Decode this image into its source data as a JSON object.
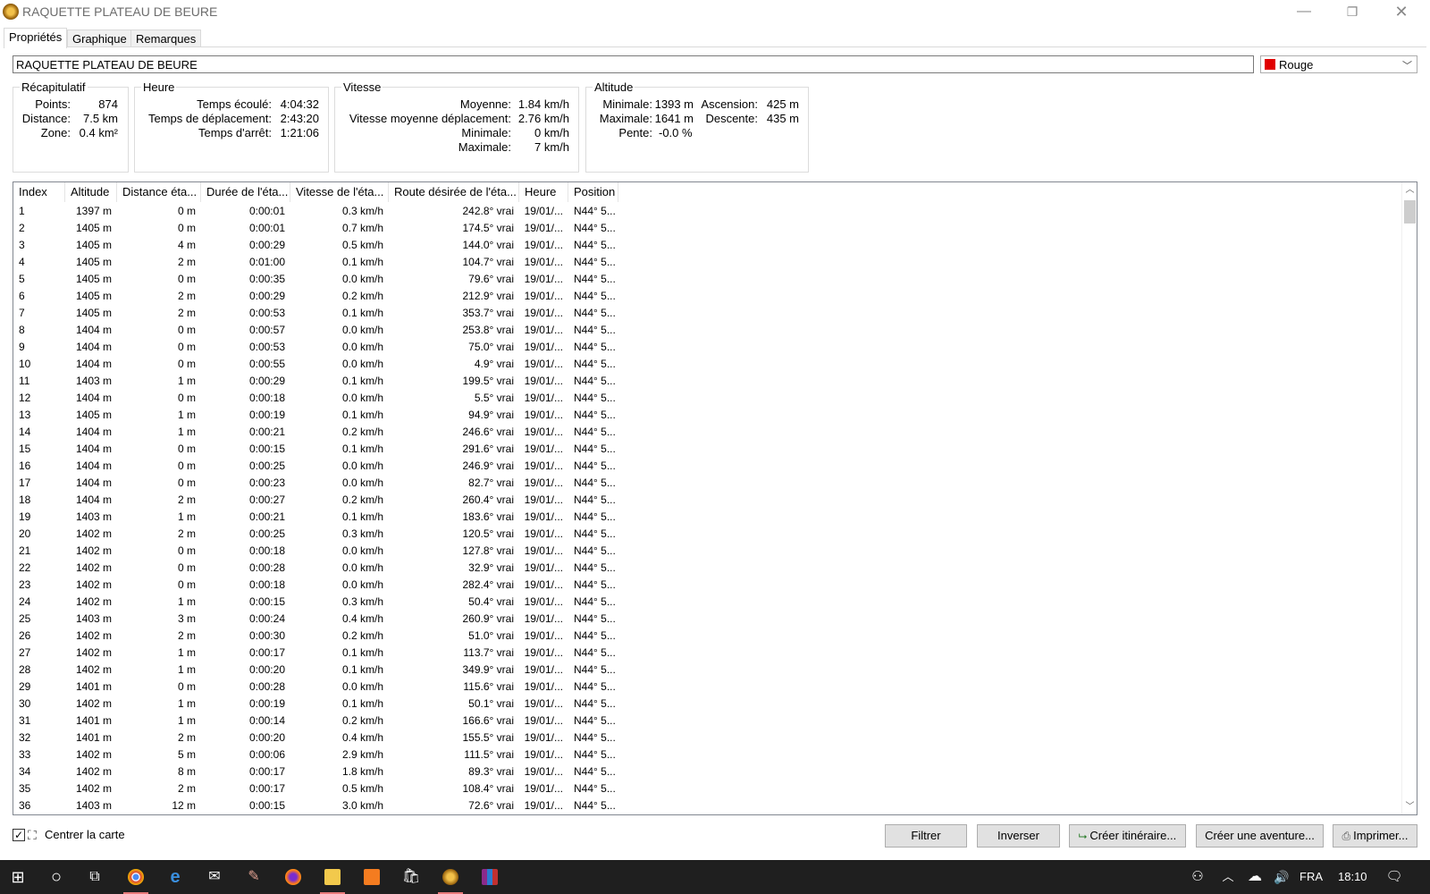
{
  "window": {
    "title": "RAQUETTE PLATEAU DE BEURE"
  },
  "tabs": [
    "Propriétés",
    "Graphique",
    "Remarques"
  ],
  "name_field": {
    "value": "RAQUETTE PLATEAU DE BEURE"
  },
  "color_select": {
    "value": "Rouge",
    "swatch_color": "#e00000"
  },
  "summary": {
    "title": "Récapitulatif",
    "points_label": "Points:",
    "points": "874",
    "distance_label": "Distance:",
    "distance": "7.5 km",
    "zone_label": "Zone:",
    "zone": "0.4 km²"
  },
  "time": {
    "title": "Heure",
    "elapsed_label": "Temps écoulé:",
    "elapsed": "4:04:32",
    "moving_label": "Temps de déplacement:",
    "moving": "2:43:20",
    "stopped_label": "Temps d'arrêt:",
    "stopped": "1:21:06"
  },
  "speed": {
    "title": "Vitesse",
    "avg_label": "Moyenne:",
    "avg": "1.84 km/h",
    "moving_avg_label": "Vitesse moyenne déplacement:",
    "moving_avg": "2.76 km/h",
    "min_label": "Minimale:",
    "min": "0 km/h",
    "max_label": "Maximale:",
    "max": "7 km/h"
  },
  "altitude": {
    "title": "Altitude",
    "min_label": "Minimale:",
    "min": "1393 m",
    "max_label": "Maximale:",
    "max": "1641 m",
    "slope_label": "Pente:",
    "slope": "-0.0 %",
    "ascent_label": "Ascension:",
    "ascent": "425 m",
    "descent_label": "Descente:",
    "descent": "435 m"
  },
  "table": {
    "columns": [
      "Index",
      "Altitude",
      "Distance éta...",
      "Durée de l'éta...",
      "Vitesse de l'éta...",
      "Route désirée de l'éta...",
      "Heure",
      "Position"
    ],
    "rows": [
      [
        "1",
        "1397 m",
        "0 m",
        "0:00:01",
        "0.3 km/h",
        "242.8° vrai",
        "19/01/...",
        "N44° 5..."
      ],
      [
        "2",
        "1405 m",
        "0 m",
        "0:00:01",
        "0.7 km/h",
        "174.5° vrai",
        "19/01/...",
        "N44° 5..."
      ],
      [
        "3",
        "1405 m",
        "4 m",
        "0:00:29",
        "0.5 km/h",
        "144.0° vrai",
        "19/01/...",
        "N44° 5..."
      ],
      [
        "4",
        "1405 m",
        "2 m",
        "0:01:00",
        "0.1 km/h",
        "104.7° vrai",
        "19/01/...",
        "N44° 5..."
      ],
      [
        "5",
        "1405 m",
        "0 m",
        "0:00:35",
        "0.0 km/h",
        "79.6° vrai",
        "19/01/...",
        "N44° 5..."
      ],
      [
        "6",
        "1405 m",
        "2 m",
        "0:00:29",
        "0.2 km/h",
        "212.9° vrai",
        "19/01/...",
        "N44° 5..."
      ],
      [
        "7",
        "1405 m",
        "2 m",
        "0:00:53",
        "0.1 km/h",
        "353.7° vrai",
        "19/01/...",
        "N44° 5..."
      ],
      [
        "8",
        "1404 m",
        "0 m",
        "0:00:57",
        "0.0 km/h",
        "253.8° vrai",
        "19/01/...",
        "N44° 5..."
      ],
      [
        "9",
        "1404 m",
        "0 m",
        "0:00:53",
        "0.0 km/h",
        "75.0° vrai",
        "19/01/...",
        "N44° 5..."
      ],
      [
        "10",
        "1404 m",
        "0 m",
        "0:00:55",
        "0.0 km/h",
        "4.9° vrai",
        "19/01/...",
        "N44° 5..."
      ],
      [
        "11",
        "1403 m",
        "1 m",
        "0:00:29",
        "0.1 km/h",
        "199.5° vrai",
        "19/01/...",
        "N44° 5..."
      ],
      [
        "12",
        "1404 m",
        "0 m",
        "0:00:18",
        "0.0 km/h",
        "5.5° vrai",
        "19/01/...",
        "N44° 5..."
      ],
      [
        "13",
        "1405 m",
        "1 m",
        "0:00:19",
        "0.1 km/h",
        "94.9° vrai",
        "19/01/...",
        "N44° 5..."
      ],
      [
        "14",
        "1404 m",
        "1 m",
        "0:00:21",
        "0.2 km/h",
        "246.6° vrai",
        "19/01/...",
        "N44° 5..."
      ],
      [
        "15",
        "1404 m",
        "0 m",
        "0:00:15",
        "0.1 km/h",
        "291.6° vrai",
        "19/01/...",
        "N44° 5..."
      ],
      [
        "16",
        "1404 m",
        "0 m",
        "0:00:25",
        "0.0 km/h",
        "246.9° vrai",
        "19/01/...",
        "N44° 5..."
      ],
      [
        "17",
        "1404 m",
        "0 m",
        "0:00:23",
        "0.0 km/h",
        "82.7° vrai",
        "19/01/...",
        "N44° 5..."
      ],
      [
        "18",
        "1404 m",
        "2 m",
        "0:00:27",
        "0.2 km/h",
        "260.4° vrai",
        "19/01/...",
        "N44° 5..."
      ],
      [
        "19",
        "1403 m",
        "1 m",
        "0:00:21",
        "0.1 km/h",
        "183.6° vrai",
        "19/01/...",
        "N44° 5..."
      ],
      [
        "20",
        "1402 m",
        "2 m",
        "0:00:25",
        "0.3 km/h",
        "120.5° vrai",
        "19/01/...",
        "N44° 5..."
      ],
      [
        "21",
        "1402 m",
        "0 m",
        "0:00:18",
        "0.0 km/h",
        "127.8° vrai",
        "19/01/...",
        "N44° 5..."
      ],
      [
        "22",
        "1402 m",
        "0 m",
        "0:00:28",
        "0.0 km/h",
        "32.9° vrai",
        "19/01/...",
        "N44° 5..."
      ],
      [
        "23",
        "1402 m",
        "0 m",
        "0:00:18",
        "0.0 km/h",
        "282.4° vrai",
        "19/01/...",
        "N44° 5..."
      ],
      [
        "24",
        "1402 m",
        "1 m",
        "0:00:15",
        "0.3 km/h",
        "50.4° vrai",
        "19/01/...",
        "N44° 5..."
      ],
      [
        "25",
        "1403 m",
        "3 m",
        "0:00:24",
        "0.4 km/h",
        "260.9° vrai",
        "19/01/...",
        "N44° 5..."
      ],
      [
        "26",
        "1402 m",
        "2 m",
        "0:00:30",
        "0.2 km/h",
        "51.0° vrai",
        "19/01/...",
        "N44° 5..."
      ],
      [
        "27",
        "1402 m",
        "1 m",
        "0:00:17",
        "0.1 km/h",
        "113.7° vrai",
        "19/01/...",
        "N44° 5..."
      ],
      [
        "28",
        "1402 m",
        "1 m",
        "0:00:20",
        "0.1 km/h",
        "349.9° vrai",
        "19/01/...",
        "N44° 5..."
      ],
      [
        "29",
        "1401 m",
        "0 m",
        "0:00:28",
        "0.0 km/h",
        "115.6° vrai",
        "19/01/...",
        "N44° 5..."
      ],
      [
        "30",
        "1402 m",
        "1 m",
        "0:00:19",
        "0.1 km/h",
        "50.1° vrai",
        "19/01/...",
        "N44° 5..."
      ],
      [
        "31",
        "1401 m",
        "1 m",
        "0:00:14",
        "0.2 km/h",
        "166.6° vrai",
        "19/01/...",
        "N44° 5..."
      ],
      [
        "32",
        "1401 m",
        "2 m",
        "0:00:20",
        "0.4 km/h",
        "155.5° vrai",
        "19/01/...",
        "N44° 5..."
      ],
      [
        "33",
        "1402 m",
        "5 m",
        "0:00:06",
        "2.9 km/h",
        "111.5° vrai",
        "19/01/...",
        "N44° 5..."
      ],
      [
        "34",
        "1402 m",
        "8 m",
        "0:00:17",
        "1.8 km/h",
        "89.3° vrai",
        "19/01/...",
        "N44° 5..."
      ],
      [
        "35",
        "1402 m",
        "2 m",
        "0:00:17",
        "0.5 km/h",
        "108.4° vrai",
        "19/01/...",
        "N44° 5..."
      ],
      [
        "36",
        "1403 m",
        "12 m",
        "0:00:15",
        "3.0 km/h",
        "72.6° vrai",
        "19/01/...",
        "N44° 5..."
      ]
    ]
  },
  "bottom": {
    "center_map_label": "Centrer la carte",
    "center_map_checked": true,
    "filter": "Filtrer",
    "invert": "Inverser",
    "create_route": "Créer itinéraire...",
    "create_adventure": "Créer une aventure...",
    "print": "Imprimer..."
  },
  "taskbar": {
    "language": "FRA",
    "time": "18:10"
  }
}
